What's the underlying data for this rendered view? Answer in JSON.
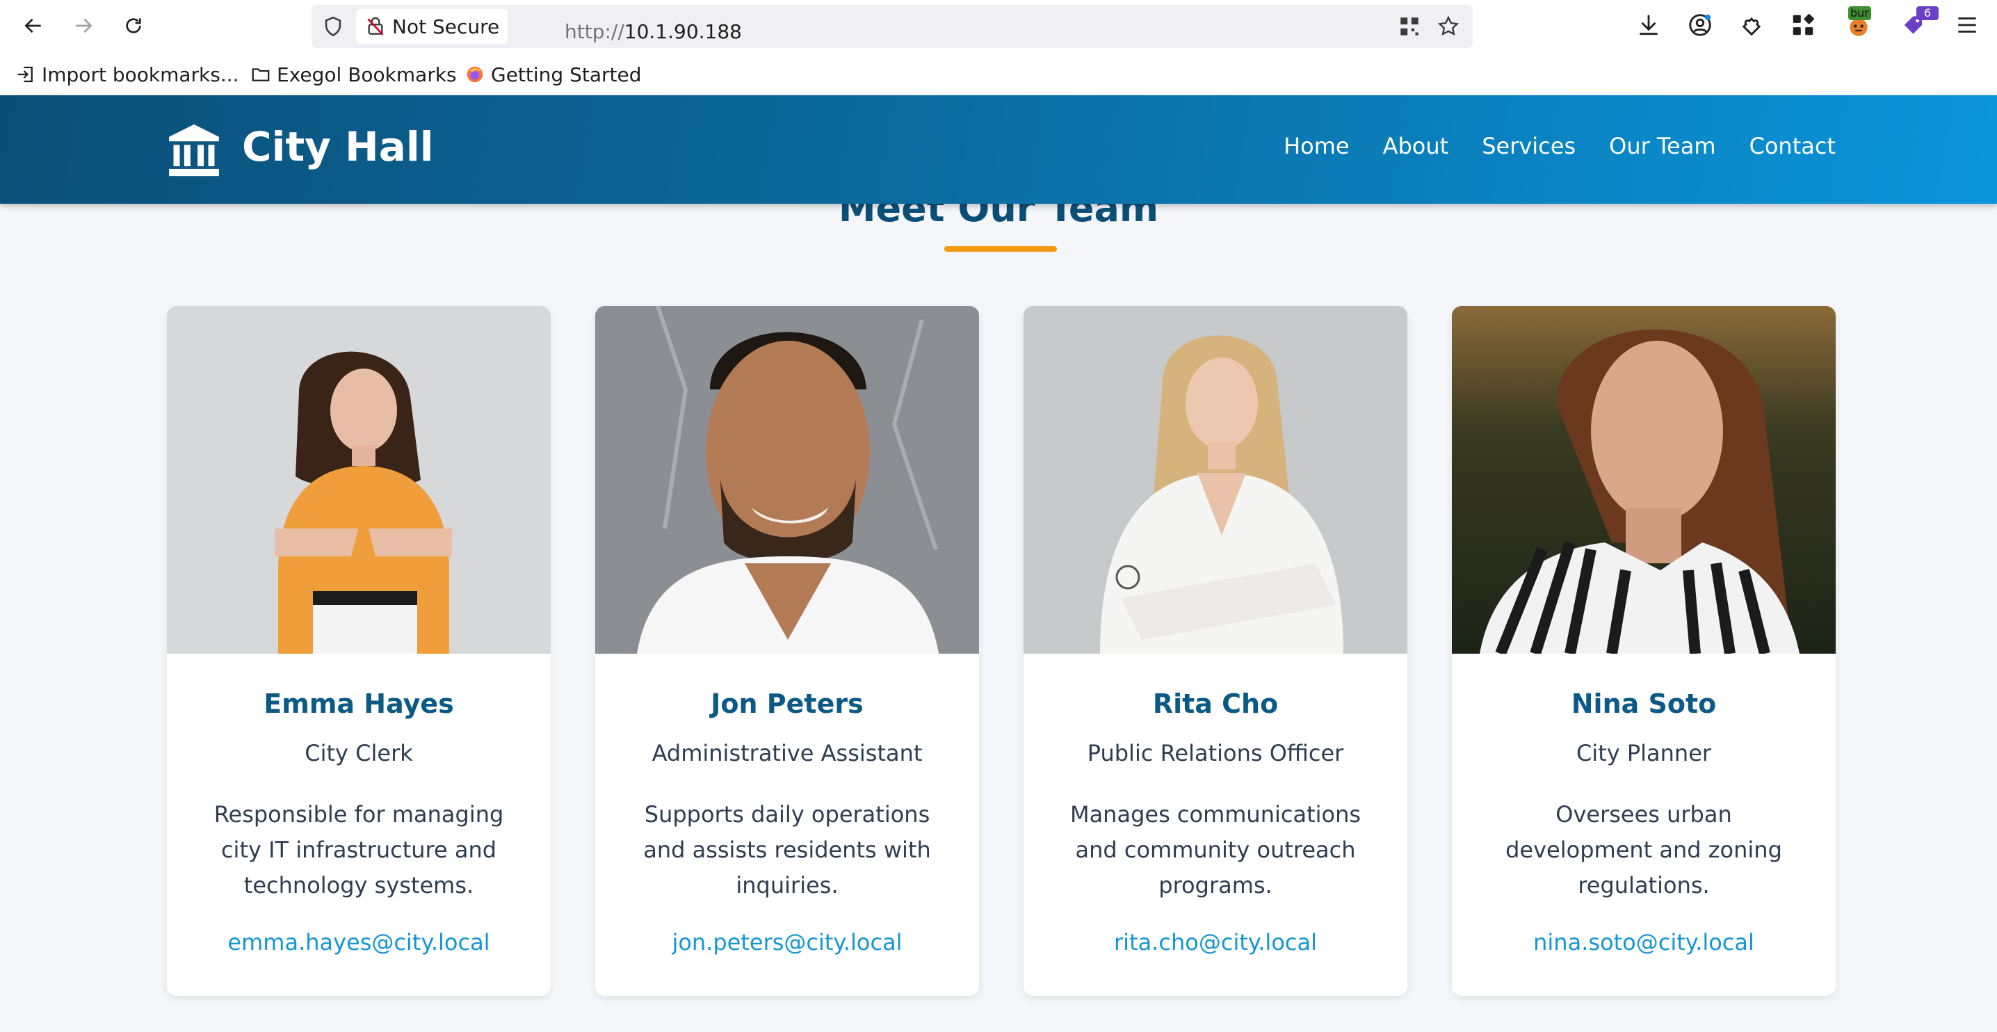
{
  "browser": {
    "security_label": "Not Secure",
    "url_protocol": "http://",
    "url_host": "10.1.90.188",
    "extension_badge_1": "bur",
    "extension_badge_2": "6",
    "bookmarks": [
      {
        "label": "Import bookmarks...",
        "icon": "import-icon"
      },
      {
        "label": "Exegol Bookmarks",
        "icon": "folder-icon"
      },
      {
        "label": "Getting Started",
        "icon": "firefox-icon"
      }
    ]
  },
  "site": {
    "title": "City Hall",
    "logo_icon": "building-columns-icon",
    "nav": [
      "Home",
      "About",
      "Services",
      "Our Team",
      "Contact"
    ]
  },
  "section": {
    "title": "Meet Our Team",
    "accent_color": "#f29a11"
  },
  "team": [
    {
      "name": "Emma Hayes",
      "role": "City Clerk",
      "description": "Responsible for managing city IT infrastructure and technology systems.",
      "email": "emma.hayes@city.local"
    },
    {
      "name": "Jon Peters",
      "role": "Administrative Assistant",
      "description": "Supports daily operations and assists residents with inquiries.",
      "email": "jon.peters@city.local"
    },
    {
      "name": "Rita Cho",
      "role": "Public Relations Officer",
      "description": "Manages communications and community outreach programs.",
      "email": "rita.cho@city.local"
    },
    {
      "name": "Nina Soto",
      "role": "City Planner",
      "description": "Oversees urban development and zoning regulations.",
      "email": "nina.soto@city.local"
    }
  ],
  "colors": {
    "header_start": "#0b4f78",
    "header_end": "#0a95da",
    "name_color": "#0b5a86",
    "link_color": "#1496d4"
  }
}
